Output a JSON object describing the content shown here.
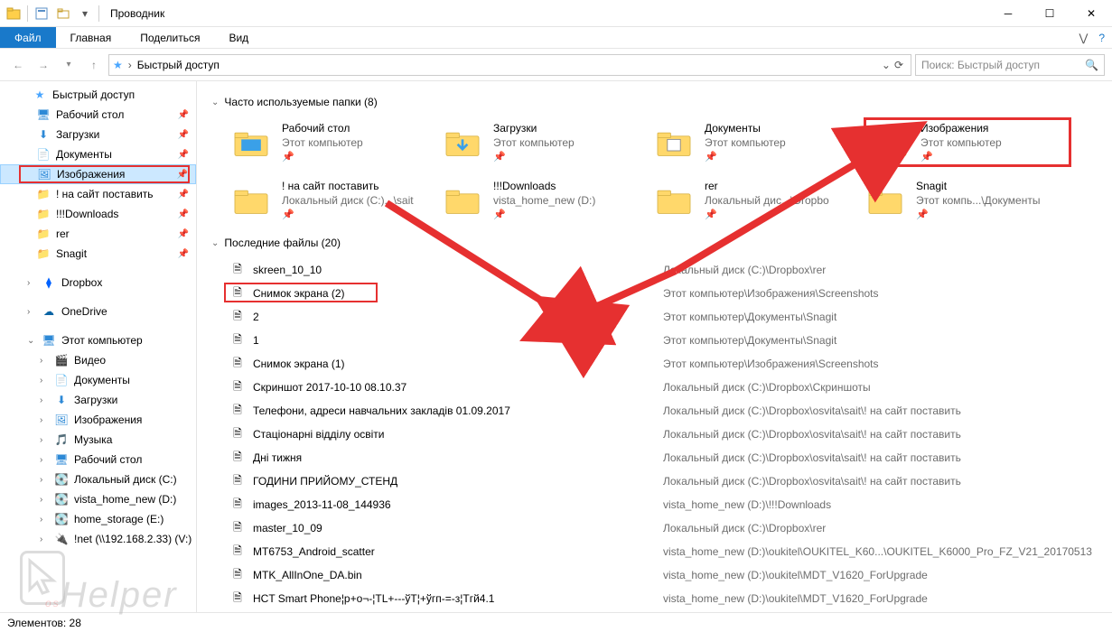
{
  "titlebar": {
    "title": "Проводник"
  },
  "ribbon": {
    "file": "Файл",
    "tabs": [
      "Главная",
      "Поделиться",
      "Вид"
    ]
  },
  "address": {
    "path_label": "Быстрый доступ",
    "search_placeholder": "Поиск: Быстрый доступ"
  },
  "sidebar": {
    "quick_access": "Быстрый доступ",
    "items_pinned": [
      {
        "label": "Рабочий стол",
        "icon": "desktop"
      },
      {
        "label": "Загрузки",
        "icon": "down"
      },
      {
        "label": "Документы",
        "icon": "doc"
      },
      {
        "label": "Изображения",
        "icon": "img",
        "highlighted": true
      },
      {
        "label": "! на сайт поставить",
        "icon": "fold"
      },
      {
        "label": "!!!Downloads",
        "icon": "fold"
      },
      {
        "label": "rer",
        "icon": "fold"
      },
      {
        "label": "Snagit",
        "icon": "fold"
      }
    ],
    "dropbox": "Dropbox",
    "onedrive": "OneDrive",
    "this_pc": "Этот компьютер",
    "pc_items": [
      {
        "label": "Видео"
      },
      {
        "label": "Документы"
      },
      {
        "label": "Загрузки"
      },
      {
        "label": "Изображения"
      },
      {
        "label": "Музыка"
      },
      {
        "label": "Рабочий стол"
      },
      {
        "label": "Локальный диск (C:)"
      },
      {
        "label": "vista_home_new (D:)"
      },
      {
        "label": "home_storage (E:)"
      },
      {
        "label": "!net (\\\\192.168.2.33) (V:)"
      }
    ]
  },
  "content": {
    "group1_title": "Часто используемые папки (8)",
    "folders": [
      {
        "name": "Рабочий стол",
        "sub": "Этот компьютер",
        "pinned": true,
        "icon": "desktop"
      },
      {
        "name": "Загрузки",
        "sub": "Этот компьютер",
        "pinned": true,
        "icon": "down"
      },
      {
        "name": "Документы",
        "sub": "Этот компьютер",
        "pinned": true,
        "icon": "doc"
      },
      {
        "name": "Изображения",
        "sub": "Этот компьютер",
        "pinned": true,
        "icon": "img",
        "highlighted": true
      },
      {
        "name": "! на сайт поставить",
        "sub": "Локальный диск (C:)...\\sait",
        "pinned": true,
        "icon": "fold"
      },
      {
        "name": "!!!Downloads",
        "sub": "vista_home_new (D:)",
        "pinned": true,
        "icon": "fold"
      },
      {
        "name": "rer",
        "sub": "Локальный дис...\\Dropbo",
        "pinned": true,
        "icon": "fold"
      },
      {
        "name": "Snagit",
        "sub": "Этот компь...\\Документы",
        "pinned": true,
        "icon": "fold"
      }
    ],
    "group2_title": "Последние файлы (20)",
    "files": [
      {
        "name": "skreen_10_10",
        "path": "Локальный диск (C:)\\Dropbox\\rer"
      },
      {
        "name": "Снимок экрана (2)",
        "path": "Этот компьютер\\Изображения\\Screenshots",
        "highlighted": true
      },
      {
        "name": "2",
        "path": "Этот компьютер\\Документы\\Snagit"
      },
      {
        "name": "1",
        "path": "Этот компьютер\\Документы\\Snagit"
      },
      {
        "name": "Снимок экрана (1)",
        "path": "Этот компьютер\\Изображения\\Screenshots"
      },
      {
        "name": "Скриншот 2017-10-10 08.10.37",
        "path": "Локальный диск (C:)\\Dropbox\\Скриншоты"
      },
      {
        "name": "Телефони, адреси навчальних закладів 01.09.2017",
        "path": "Локальный диск (C:)\\Dropbox\\osvita\\sait\\! на сайт поставить"
      },
      {
        "name": "Стаціонарні відділу освіти",
        "path": "Локальный диск (C:)\\Dropbox\\osvita\\sait\\! на сайт поставить"
      },
      {
        "name": "Дні тижня",
        "path": "Локальный диск (C:)\\Dropbox\\osvita\\sait\\! на сайт поставить"
      },
      {
        "name": "ГОДИНИ ПРИЙОМУ_СТЕНД",
        "path": "Локальный диск (C:)\\Dropbox\\osvita\\sait\\! на сайт поставить"
      },
      {
        "name": "images_2013-11-08_144936",
        "path": "vista_home_new (D:)\\!!!Downloads"
      },
      {
        "name": "master_10_09",
        "path": "Локальный диск (C:)\\Dropbox\\rer"
      },
      {
        "name": "MT6753_Android_scatter",
        "path": "vista_home_new (D:)\\oukitel\\OUKITEL_K60...\\OUKITEL_K6000_Pro_FZ_V21_20170513"
      },
      {
        "name": "MTK_AllInOne_DA.bin",
        "path": "vista_home_new (D:)\\oukitel\\MDT_V1620_ForUpgrade"
      },
      {
        "name": "HCT Smart Phone¦p+o¬-¦TL+---ўT¦+ўгп-=-з¦Тгй4.1",
        "path": "vista_home_new (D:)\\oukitel\\MDT_V1620_ForUpgrade"
      }
    ]
  },
  "status": {
    "text": "Элементов: 28"
  },
  "watermark": "osHelper"
}
